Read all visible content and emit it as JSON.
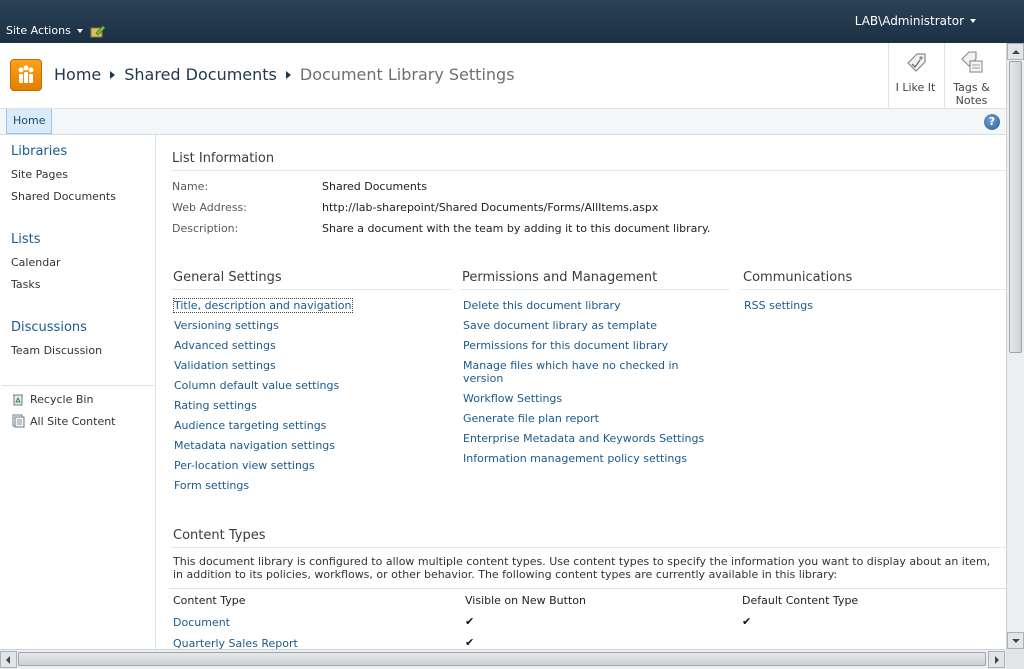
{
  "topbar": {
    "site_actions": "Site Actions",
    "user": "LAB\\Administrator"
  },
  "breadcrumb": {
    "home": "Home",
    "library": "Shared Documents",
    "current": "Document Library Settings"
  },
  "social": {
    "like": "I Like It",
    "tags_line1": "Tags &",
    "tags_line2": "Notes"
  },
  "topnav": {
    "home_tab": "Home",
    "help": "?"
  },
  "leftnav": {
    "libraries": "Libraries",
    "site_pages": "Site Pages",
    "shared_documents": "Shared Documents",
    "lists": "Lists",
    "calendar": "Calendar",
    "tasks": "Tasks",
    "discussions": "Discussions",
    "team_discussion": "Team Discussion",
    "recycle_bin": "Recycle Bin",
    "all_site_content": "All Site Content"
  },
  "list_info": {
    "title": "List Information",
    "name_label": "Name:",
    "name_value": "Shared Documents",
    "address_label": "Web Address:",
    "address_value": "http://lab-sharepoint/Shared Documents/Forms/AllItems.aspx",
    "description_label": "Description:",
    "description_value": "Share a document with the team by adding it to this document library."
  },
  "general_settings": {
    "title": "General Settings",
    "links": [
      "Title, description and navigation",
      "Versioning settings",
      "Advanced settings",
      "Validation settings",
      "Column default value settings",
      "Rating settings",
      "Audience targeting settings",
      "Metadata navigation settings",
      "Per-location view settings",
      "Form settings"
    ]
  },
  "permissions": {
    "title": "Permissions and Management",
    "links": [
      "Delete this document library",
      "Save document library as template",
      "Permissions for this document library",
      "Manage files which have no checked in version",
      "Workflow Settings",
      "Generate file plan report",
      "Enterprise Metadata and Keywords Settings",
      "Information management policy settings"
    ]
  },
  "communications": {
    "title": "Communications",
    "links": [
      "RSS settings"
    ]
  },
  "content_types": {
    "title": "Content Types",
    "description": "This document library is configured to allow multiple content types. Use content types to specify the information you want to display about an item, in addition to its policies, workflows, or other behavior. The following content types are currently available in this library:",
    "col_type": "Content Type",
    "col_visible": "Visible on New Button",
    "col_default": "Default Content Type",
    "check": "✔",
    "rows": [
      {
        "name": "Document"
      },
      {
        "name": "Quarterly Sales Report"
      }
    ]
  },
  "colors": {
    "topbar": "#21374c",
    "link": "#1b5a8c",
    "logo": "#f39800"
  }
}
